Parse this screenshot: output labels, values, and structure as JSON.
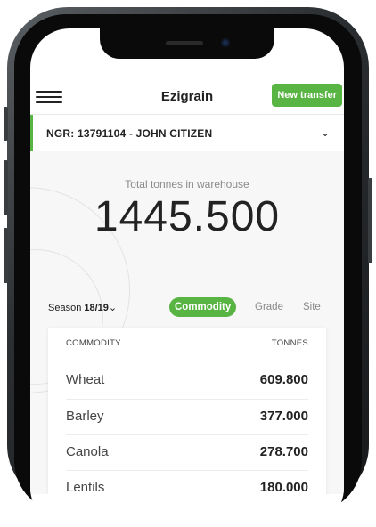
{
  "app": {
    "title": "Ezigrain",
    "new_transfer_label": "New transfer"
  },
  "account": {
    "ngr_label": "NGR: 13791104 - JOHN CITIZEN"
  },
  "summary": {
    "total_label": "Total tonnes in warehouse",
    "total_value": "1445.500"
  },
  "season": {
    "prefix": "Season",
    "value": "18/19"
  },
  "tabs": [
    {
      "label": "Commodity",
      "active": true
    },
    {
      "label": "Grade",
      "active": false
    },
    {
      "label": "Site",
      "active": false
    }
  ],
  "table": {
    "headers": {
      "commodity": "COMMODITY",
      "tonnes": "TONNES"
    },
    "rows": [
      {
        "commodity": "Wheat",
        "tonnes": "609.800"
      },
      {
        "commodity": "Barley",
        "tonnes": "377.000"
      },
      {
        "commodity": "Canola",
        "tonnes": "278.700"
      },
      {
        "commodity": "Lentils",
        "tonnes": "180.000"
      }
    ]
  },
  "colors": {
    "accent": "#58b443",
    "text": "#222222",
    "muted": "#888888"
  },
  "icons": {
    "menu": "hamburger-menu-icon",
    "dropdown": "chevron-down-icon"
  }
}
